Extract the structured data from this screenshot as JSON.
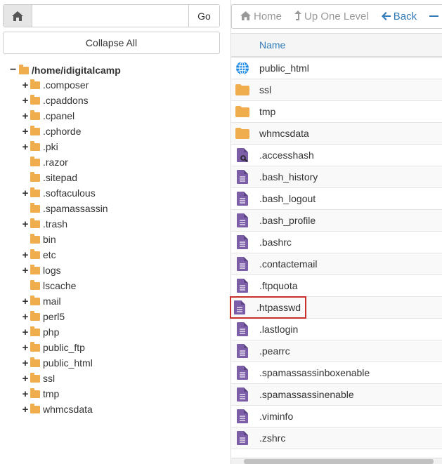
{
  "nav": {
    "path_value": "",
    "go_label": "Go"
  },
  "collapse_label": "Collapse All",
  "tree": {
    "root": "/home/idigitalcamp",
    "items": [
      {
        "label": ".composer",
        "expandable": true
      },
      {
        "label": ".cpaddons",
        "expandable": true
      },
      {
        "label": ".cpanel",
        "expandable": true
      },
      {
        "label": ".cphorde",
        "expandable": true
      },
      {
        "label": ".pki",
        "expandable": true
      },
      {
        "label": ".razor",
        "expandable": false
      },
      {
        "label": ".sitepad",
        "expandable": false
      },
      {
        "label": ".softaculous",
        "expandable": true
      },
      {
        "label": ".spamassassin",
        "expandable": false
      },
      {
        "label": ".trash",
        "expandable": true
      },
      {
        "label": "bin",
        "expandable": false
      },
      {
        "label": "etc",
        "expandable": true
      },
      {
        "label": "logs",
        "expandable": true
      },
      {
        "label": "lscache",
        "expandable": false
      },
      {
        "label": "mail",
        "expandable": true
      },
      {
        "label": "perl5",
        "expandable": true
      },
      {
        "label": "php",
        "expandable": true
      },
      {
        "label": "public_ftp",
        "expandable": true
      },
      {
        "label": "public_html",
        "expandable": true
      },
      {
        "label": "ssl",
        "expandable": true
      },
      {
        "label": "tmp",
        "expandable": true
      },
      {
        "label": "whmcsdata",
        "expandable": true
      }
    ]
  },
  "toolbar": {
    "home_label": "Home",
    "up_label": "Up One Level",
    "back_label": "Back"
  },
  "table": {
    "header_name": "Name",
    "rows": [
      {
        "name": "public_html",
        "icon": "globe-icon"
      },
      {
        "name": "ssl",
        "icon": "folder-icon"
      },
      {
        "name": "tmp",
        "icon": "folder-icon"
      },
      {
        "name": "whmcsdata",
        "icon": "folder-icon"
      },
      {
        "name": ".accesshash",
        "icon": "file-key-icon"
      },
      {
        "name": ".bash_history",
        "icon": "file-text-icon"
      },
      {
        "name": ".bash_logout",
        "icon": "file-text-icon"
      },
      {
        "name": ".bash_profile",
        "icon": "file-text-icon"
      },
      {
        "name": ".bashrc",
        "icon": "file-text-icon"
      },
      {
        "name": ".contactemail",
        "icon": "file-text-icon"
      },
      {
        "name": ".ftpquota",
        "icon": "file-text-icon"
      },
      {
        "name": ".htpasswd",
        "icon": "file-text-icon",
        "highlighted": true
      },
      {
        "name": ".lastlogin",
        "icon": "file-text-icon"
      },
      {
        "name": ".pearrc",
        "icon": "file-text-icon"
      },
      {
        "name": ".spamassassinboxenable",
        "icon": "file-text-icon"
      },
      {
        "name": ".spamassassinenable",
        "icon": "file-text-icon"
      },
      {
        "name": ".viminfo",
        "icon": "file-text-icon"
      },
      {
        "name": ".zshrc",
        "icon": "file-text-icon"
      }
    ]
  },
  "colors": {
    "folder": "#f0ad4e",
    "file": "#7b5ea7",
    "link": "#337ab7",
    "highlight": "#c9302c",
    "globe": "#1e88e5"
  }
}
